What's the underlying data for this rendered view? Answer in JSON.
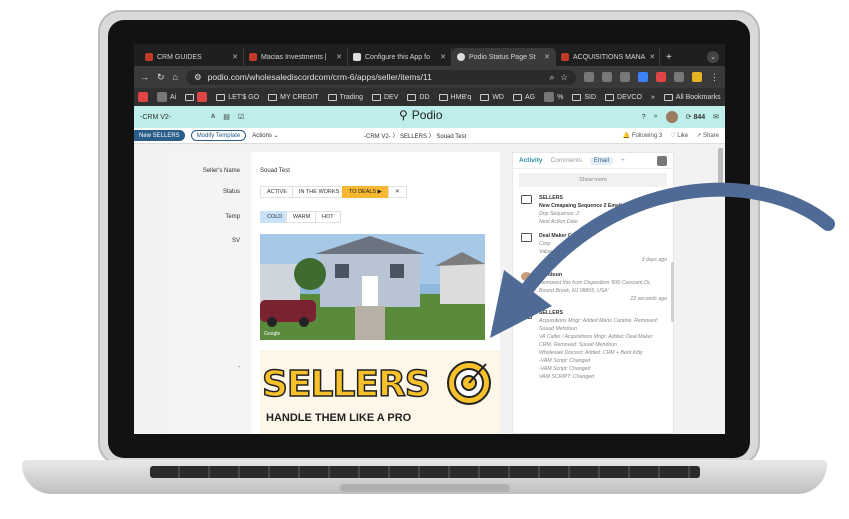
{
  "browser": {
    "tabs": [
      {
        "label": "CRM GUIDES"
      },
      {
        "label": "Macias Investments |"
      },
      {
        "label": "Configure this App fo"
      },
      {
        "label": "Podio Status Page St"
      },
      {
        "label": "ACQUISITIONS MANA"
      }
    ],
    "new_tab": "+",
    "url": "podio.com/wholesalediscordcom/crm-6/apps/seller/items/11",
    "bookmarks": [
      "Ai",
      "LET'$ GO",
      "MY CREDIT",
      "Trading",
      "DEV",
      "DD",
      "HMB'q",
      "WD",
      "AG",
      "%",
      "SID",
      "DEVCO",
      "»",
      "All Bookmarks"
    ]
  },
  "podio": {
    "workspace": "-CRM V2-",
    "logo_text": "Podio",
    "count_badge": "844",
    "new_button": "New SELLERS",
    "modify_button": "Modify Template",
    "actions_label": "Actions",
    "breadcrumb": "-CRM V2- 〉 SELLERS 〉 Souad Test",
    "following": "Following",
    "following_count": "3",
    "like": "Like",
    "share": "Share"
  },
  "record": {
    "fields": [
      {
        "label": "Seller's Name",
        "value": "Souad Test"
      },
      {
        "label": "Status"
      },
      {
        "label": "Temp"
      },
      {
        "label": "SV"
      },
      {
        "label": "-"
      }
    ],
    "status_options": [
      "ACTIVE",
      "IN THE WORKS ✓",
      "TO DEALS ▶",
      "✕"
    ],
    "status_selected": "TO DEALS ▶",
    "temp_options": [
      "COLD",
      "WARM",
      "HOT"
    ],
    "temp_selected": "COLD",
    "photo_watermark": "Google",
    "banner_title": "SELLERS",
    "banner_subtitle": "HANDLE THEM LIKE A PRO"
  },
  "activity": {
    "tabs": [
      "Activity",
      "Comments",
      "Email",
      "+"
    ],
    "show_more": "Show more",
    "items": [
      {
        "title": "SELLERS",
        "line1": "New Cmapaing Sequence 2 Email",
        "line2": "Drip Sequence: 2",
        "line3": "Next Action Date"
      },
      {
        "title": "Deal Maker C",
        "line1": "Corp",
        "line2": "Value",
        "line3": "3 days ago"
      },
      {
        "title": "Mehdoun",
        "line1": "Removed this from Disposition '830 Crescent Dr,",
        "line2": "Bound Brook, NJ 08805, USA'",
        "line3": "22 seconds ago"
      },
      {
        "title": "SELLERS",
        "line1": "Acquisitions Mngr: Added Mario Cantine. Removed: Souad Mehdoun",
        "line2": "VA Caller / Acquisitions Mngr: Added: Deal Maker CRM. Removed: Souad Mehdoun",
        "line3": "Wholesale Discord: Added: CRM + Bent Kitty"
      },
      {
        "title": "",
        "line1": "-VAM Script: Changed",
        "line2": "-VAM Script: Changed",
        "line3": "VAM SCRIPT: Changed"
      }
    ]
  },
  "colors": {
    "podio_teal": "#bdeeea",
    "accent_blue": "#2a5d8a",
    "selected_yellow": "#f7b731",
    "arrow": "#4f6b95"
  }
}
